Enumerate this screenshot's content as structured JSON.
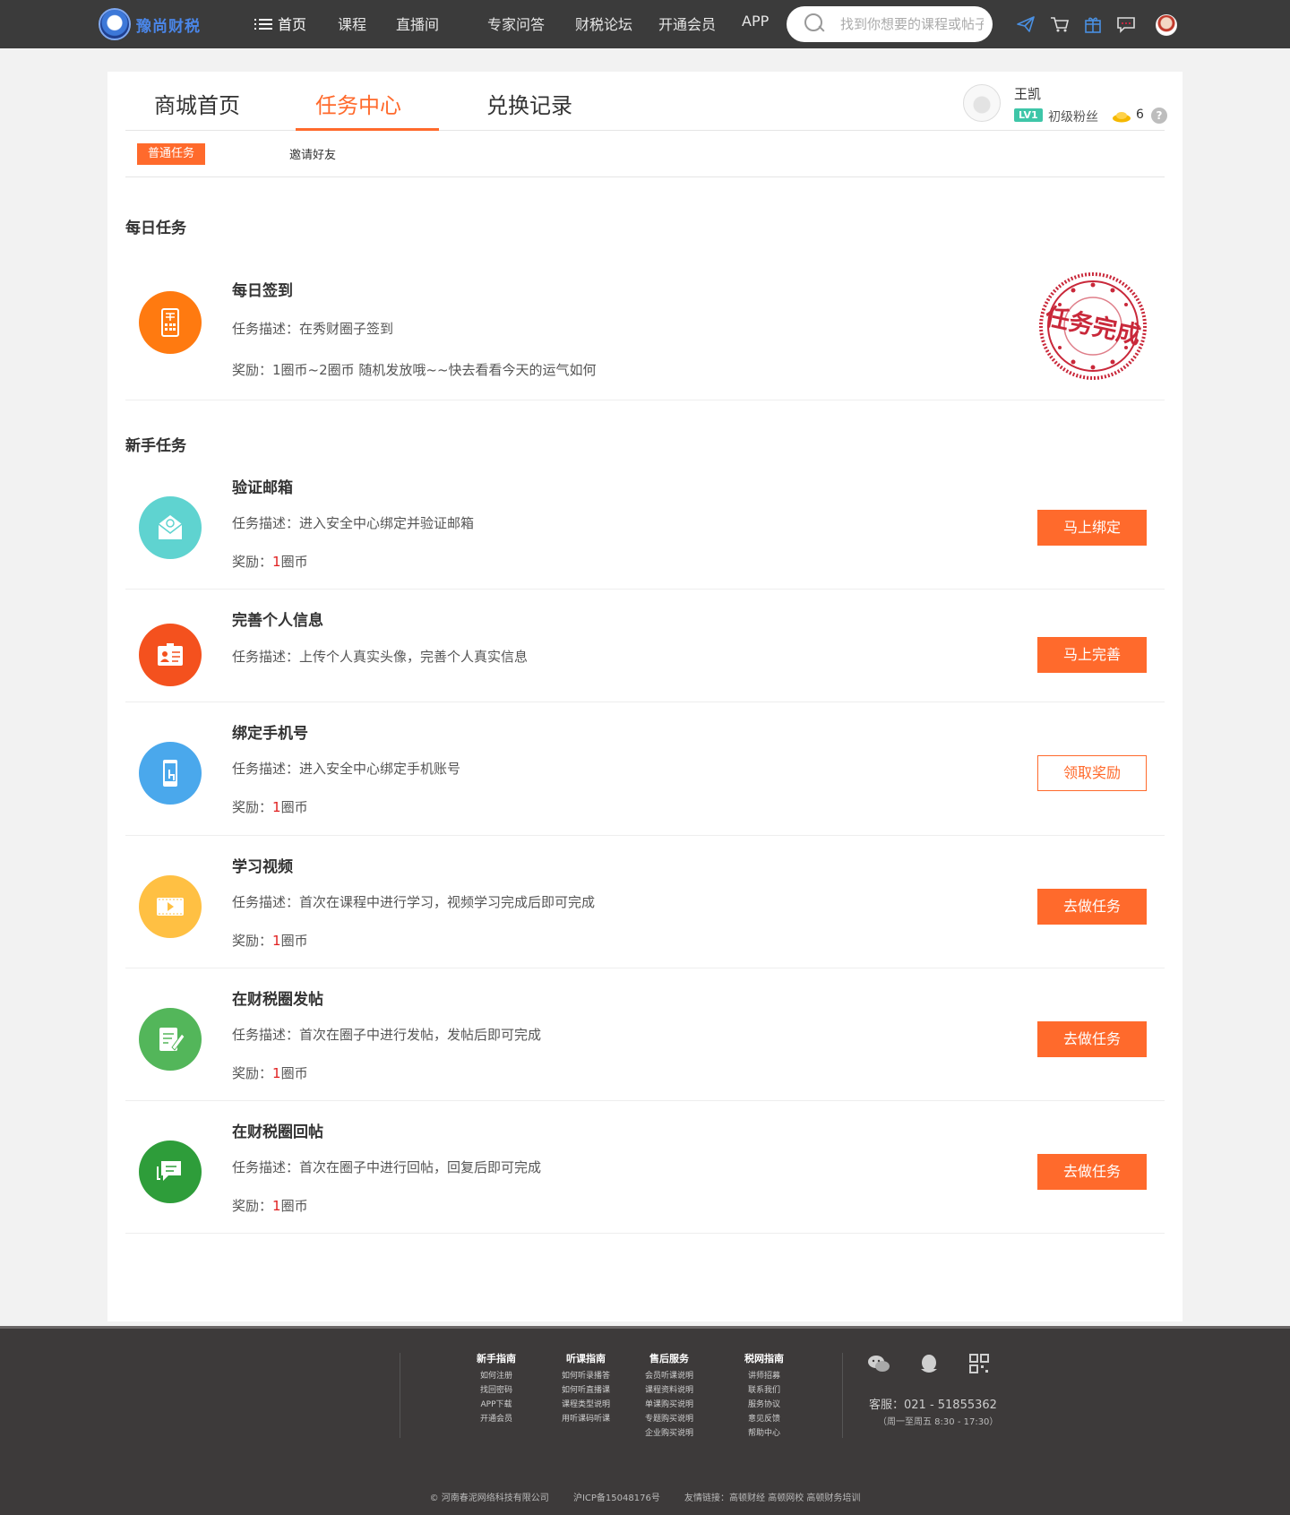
{
  "header": {
    "brand": "豫尚财税",
    "nav": [
      "首页",
      "课程",
      "直播间",
      "专家问答",
      "财税论坛",
      "开通会员",
      "APP"
    ],
    "search_placeholder": "找到你想要的课程或帖子",
    "icons": [
      "plane-icon",
      "cart-icon",
      "gift-icon",
      "chat-icon",
      "avatar"
    ]
  },
  "tabs": [
    "商城首页",
    "任务中心",
    "兑换记录"
  ],
  "active_tab": "任务中心",
  "user": {
    "name": "王凯",
    "level": "LV1",
    "title": "初级粉丝",
    "coins": "6",
    "help": "?"
  },
  "subtabs": {
    "active": "普通任务",
    "other": "邀请好友"
  },
  "daily": {
    "section": "每日任务",
    "task": {
      "title": "每日签到",
      "desc": "任务描述：在秀财圈子签到",
      "reward": "奖励：1圈币~2圈币 随机发放哦~~快去看看今天的运气如何",
      "stamp": "任务完成",
      "icon": "sign-in-icon",
      "color": "#ff7a10"
    }
  },
  "newbie": {
    "section": "新手任务",
    "reward_prefix": "奖励：",
    "reward_num": "1",
    "reward_unit": "圈币",
    "tasks": [
      {
        "title": "验证邮箱",
        "desc": "任务描述：进入安全中心绑定并验证邮箱",
        "button": "马上绑定",
        "style": "fill",
        "icon": "email-icon",
        "color": "#5fd3d0"
      },
      {
        "title": "完善个人信息",
        "desc": "任务描述：上传个人真实头像，完善个人真实信息",
        "button": "马上完善",
        "style": "fill",
        "icon": "profile-card-icon",
        "color": "#f4511e"
      },
      {
        "title": "绑定手机号",
        "desc": "任务描述：进入安全中心绑定手机账号",
        "button": "领取奖励",
        "style": "outline",
        "icon": "phone-icon",
        "color": "#4aa8ec"
      },
      {
        "title": "学习视频",
        "desc": "任务描述：首次在课程中进行学习，视频学习完成后即可完成",
        "button": "去做任务",
        "style": "fill",
        "icon": "video-icon",
        "color": "#ffc043"
      },
      {
        "title": "在财税圈发帖",
        "desc": "任务描述：首次在圈子中进行发帖，发帖后即可完成",
        "button": "去做任务",
        "style": "fill",
        "icon": "post-edit-icon",
        "color": "#53b65a"
      },
      {
        "title": "在财税圈回帖",
        "desc": "任务描述：首次在圈子中进行回帖，回复后即可完成",
        "button": "去做任务",
        "style": "fill",
        "icon": "reply-icon",
        "color": "#2e9d3a"
      }
    ]
  },
  "footer": {
    "columns": [
      {
        "title": "新手指南",
        "links": [
          "如何注册",
          "找回密码",
          "APP下载",
          "开通会员"
        ]
      },
      {
        "title": "听课指南",
        "links": [
          "如何听录播答",
          "如何听直播课",
          "课程类型说明",
          "用听课码听课"
        ]
      },
      {
        "title": "售后服务",
        "links": [
          "会员听课说明",
          "课程资料说明",
          "单课购买说明",
          "专题购买说明",
          "企业购买说明"
        ]
      },
      {
        "title": "税网指南",
        "links": [
          "讲师招募",
          "联系我们",
          "服务协议",
          "意见反馈",
          "帮助中心"
        ]
      }
    ],
    "social": [
      "wechat-icon",
      "qq-icon",
      "qrcode-icon"
    ],
    "phone": "客服：021 - 51855362",
    "hours": "（周一至周五  8:30 - 17:30）",
    "copyright": [
      "© 河南春泥网络科技有限公司",
      "沪ICP备15048176号",
      "友情链接：高顿财经  高顿网校  高顿财务培训"
    ]
  }
}
